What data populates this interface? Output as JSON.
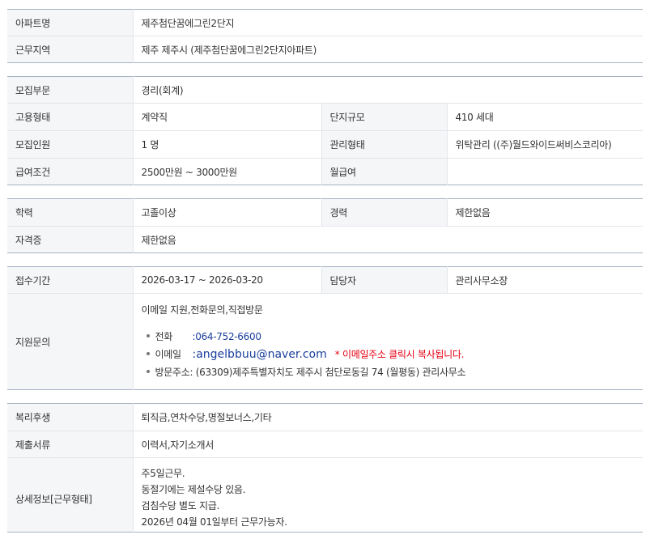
{
  "sections": {
    "basic": {
      "apt_name_label": "아파트명",
      "apt_name": "제주첨단꿈에그린2단지",
      "work_area_label": "근무지역",
      "work_area": "제주 제주시 (제주첨단꿈에그린2단지아파트)"
    },
    "recruit": {
      "field_label": "모집부문",
      "field": "경리(회계)",
      "employment_label": "고용형태",
      "employment": "계약직",
      "complex_size_label": "단지규모",
      "complex_size": "410 세대",
      "headcount_label": "모집인원",
      "headcount": "1 명",
      "mgmt_type_label": "관리형태",
      "mgmt_type": "위탁관리 ((주)월드와이드써비스코리아)",
      "salary_label": "급여조건",
      "salary": "2500만원 ~ 3000만원",
      "pay_type": "월급여",
      "pay_type_value": ""
    },
    "qualification": {
      "education_label": "학력",
      "education": "고졸이상",
      "career_label": "경력",
      "career": "제한없음",
      "license_label": "자격증",
      "license": "제한없음"
    },
    "apply": {
      "period_label": "접수기간",
      "period": "2026-03-17 ~ 2026-03-20",
      "manager_label": "담당자",
      "manager": "관리사무소장",
      "inquiry_label": "지원문의",
      "methods": "이메일 지원,전화문의,직접방문",
      "phone_label": "전화",
      "phone": ":064-752-6600",
      "email_label": "이메일",
      "email": ":angelbbuu@naver.com",
      "email_note": "* 이메일주소 클릭시 복사됩니다.",
      "visit_label": "방문주소",
      "visit": ": (63309)제주특별자치도 제주시 첨단로동길 74 (월평동) 관리사무소"
    },
    "benefits": {
      "welfare_label": "복리후생",
      "welfare": "퇴직금,연차수당,명절보너스,기타",
      "documents_label": "제출서류",
      "documents": "이력서,자기소개서",
      "detail_label": "상세정보[근무형태]",
      "detail_lines": [
        "주5일근무.",
        "동절기에는 제설수당 있음.",
        "검침수당 별도 지급.",
        "2026년 04월 01일부터 근무가능자."
      ]
    }
  },
  "colors": {
    "table_border_top": "#a6b3c4",
    "row_divider": "#e2e5ea",
    "header_bg": "#f5f6f8",
    "link_blue": "#1a3f9c",
    "note_red": "#e60012"
  }
}
